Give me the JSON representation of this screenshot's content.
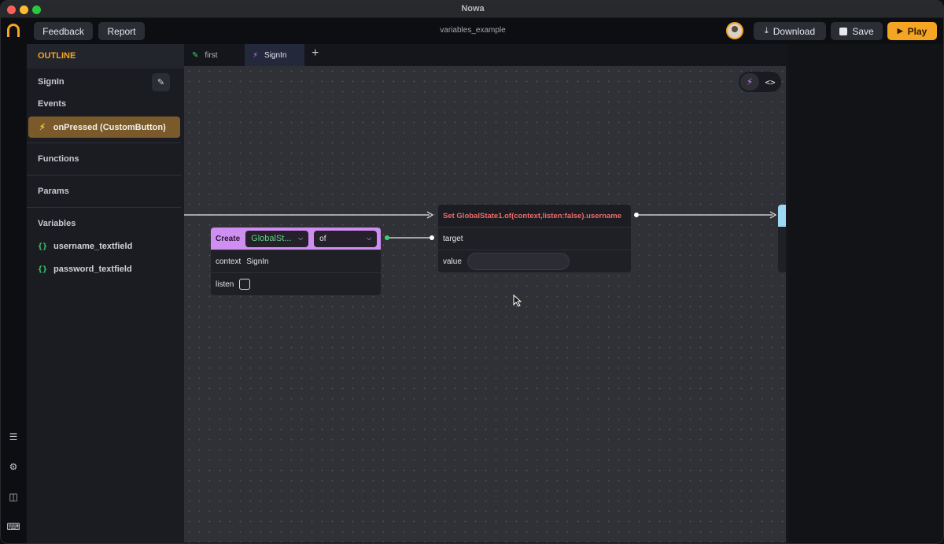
{
  "window": {
    "title": "Nowa"
  },
  "toolbar": {
    "feedback_label": "Feedback",
    "report_label": "Report",
    "document_name": "variables_example",
    "download_label": "Download",
    "save_label": "Save",
    "play_label": "Play"
  },
  "rail": {
    "icons": [
      "layers-icon",
      "gear-icon",
      "folder-icon",
      "keyboard-icon"
    ]
  },
  "outline": {
    "header": "OUTLINE",
    "screen_name": "SignIn",
    "events_label": "Events",
    "event_item": "onPressed (CustomButton)",
    "functions_label": "Functions",
    "params_label": "Params",
    "variables_label": "Variables",
    "variables": [
      "username_textfield",
      "password_textfield"
    ]
  },
  "tabs": [
    {
      "label": "first",
      "icon": "pencil-icon",
      "color": "#3fcf6e"
    },
    {
      "label": "SignIn",
      "icon": "lightning-icon",
      "color": "#c57cf5"
    }
  ],
  "canvas": {
    "create_node": {
      "title": "Create",
      "class_value": "GlobalSt...",
      "method_value": "of",
      "context_label": "context",
      "context_value": "SignIn",
      "listen_label": "listen",
      "listen_checked": false
    },
    "set_node": {
      "title": "Set GlobalState1.of(context,listen:false).username",
      "target_label": "target",
      "value_label": "value"
    },
    "next_node_head_color": "#9ed8f5"
  },
  "colors": {
    "accent": "#f5a524",
    "create_header": "#cf8ff0",
    "set_title": "#f06a6a",
    "variable_brace": "#3fcf6e"
  }
}
